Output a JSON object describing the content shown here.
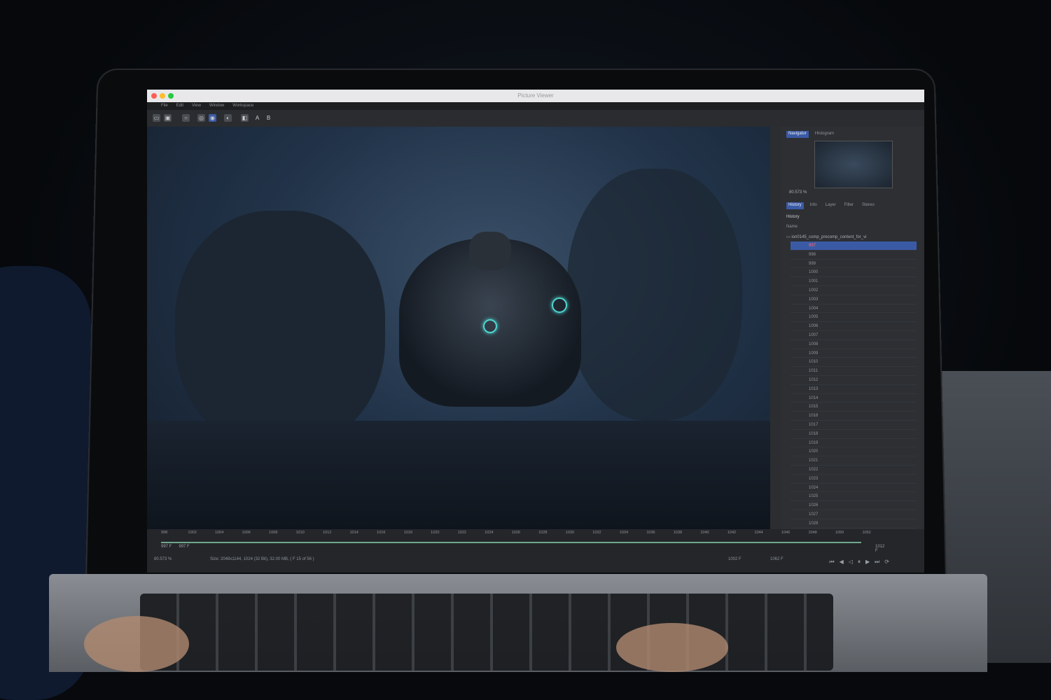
{
  "window": {
    "title": "Picture Viewer"
  },
  "menu": [
    "File",
    "Edit",
    "View",
    "Window",
    "Workspace"
  ],
  "toolbar": {
    "labels": [
      "A",
      "B"
    ]
  },
  "panel": {
    "tabs_top": [
      "Navigator",
      "Histogram"
    ],
    "zoom": "80.573 %",
    "tabs_mid": [
      "History",
      "Info",
      "Layer",
      "Filter",
      "Stereo"
    ],
    "history_header": "History",
    "name_header": "Name",
    "comp_name": "ion0145_comp_precomp_content_for_vi",
    "frames": [
      "997",
      "998",
      "999",
      "1000",
      "1001",
      "1002",
      "1003",
      "1004",
      "1005",
      "1006",
      "1007",
      "1008",
      "1009",
      "1010",
      "1011",
      "1012",
      "1013",
      "1014",
      "1015",
      "1016",
      "1017",
      "1018",
      "1019",
      "1020",
      "1021",
      "1022",
      "1023",
      "1024",
      "1025",
      "1026",
      "1027",
      "1028"
    ]
  },
  "timeline": {
    "ticks": [
      "998",
      "1002",
      "1004",
      "1006",
      "1008",
      "1010",
      "1012",
      "1014",
      "1016",
      "1018",
      "1020",
      "1022",
      "1024",
      "1026",
      "1028",
      "1030",
      "1032",
      "1034",
      "1036",
      "1038",
      "1040",
      "1042",
      "1044",
      "1046",
      "1048",
      "1050",
      "1052"
    ],
    "start_frame": "997 F",
    "current_frame": "997 F",
    "end_frame": "1012 F",
    "zoom": "80.573 %",
    "info": "Size: 2048x1144, 1024 (32 Bit), 32.00 MB,  ( F 15 of 56 )",
    "frame_a": "1002 F",
    "frame_b": "1062 F"
  },
  "colors": {
    "accent": "#3b5aa6",
    "glow": "#4fd6d0"
  },
  "icons": [
    "folder-icon",
    "save-icon",
    "zoom-icon",
    "target-icon",
    "contrast-icon",
    "channel-icon",
    "skip-start-icon",
    "step-back-icon",
    "play-back-icon",
    "pause-icon",
    "play-icon",
    "skip-end-icon",
    "loop-icon"
  ]
}
